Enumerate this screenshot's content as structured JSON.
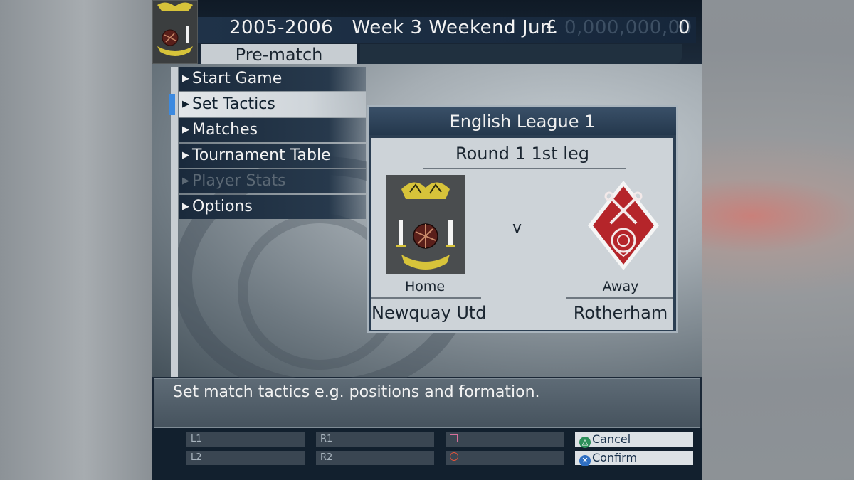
{
  "header": {
    "season": "2005-2006",
    "week": "Week 3 Weekend Jun.",
    "currency_symbol": "£",
    "money_ghost": "0,000,000,00",
    "money_value": "0",
    "screen_tab": "Pre-match"
  },
  "menu": {
    "items": [
      {
        "label": "Start Game",
        "state": "enabled"
      },
      {
        "label": "Set Tactics",
        "state": "selected"
      },
      {
        "label": "Matches",
        "state": "enabled"
      },
      {
        "label": "Tournament Table",
        "state": "enabled"
      },
      {
        "label": "Player Stats",
        "state": "disabled"
      },
      {
        "label": "Options",
        "state": "enabled"
      }
    ]
  },
  "match": {
    "competition": "English League 1",
    "round": "Round  1  1st leg",
    "versus": "v",
    "home_label": "Home",
    "away_label": "Away",
    "home_team": "Newquay Utd",
    "away_team": "Rotherham"
  },
  "help_text": "Set match tactics e.g. positions and formation.",
  "buttons": {
    "l1": "L1",
    "l2": "L2",
    "r1": "R1",
    "r2": "R2",
    "cancel": "Cancel",
    "confirm": "Confirm"
  },
  "colors": {
    "selection_accent": "#3c8ae0",
    "away_crest_red": "#b5252a"
  }
}
